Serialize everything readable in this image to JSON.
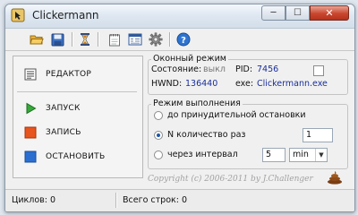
{
  "window": {
    "title": "Clickermann"
  },
  "title_buttons": {
    "minimize": "─",
    "maximize": "☐",
    "close": "✕"
  },
  "toolbar": {
    "icons": [
      "folder-open-icon",
      "save-icon",
      "hourglass-icon",
      "notepad-icon",
      "window-list-icon",
      "gear-icon",
      "help-icon"
    ]
  },
  "left_panel": {
    "editor": "РЕДАКТОР",
    "run": "ЗАПУСК",
    "record": "ЗАПИСЬ",
    "stop": "ОСТАНОВИТЬ"
  },
  "window_mode": {
    "title": "Оконный режим",
    "state_label": "Состояние:",
    "state_value": "выкл",
    "pid_label": "PID:",
    "pid_value": "7456",
    "hwnd_label": "HWND:",
    "hwnd_value": "136440",
    "exe_label": "exe:",
    "exe_value": "Clickermann.exe",
    "checkbox_checked": false
  },
  "exec_mode": {
    "title": "Режим выполнения",
    "opt_until_stop": "до принудительной остановки",
    "opt_count": "N  количество раз",
    "count_value": "1",
    "opt_interval": "через интервал",
    "interval_value": "5",
    "interval_unit": "min",
    "selected": "count"
  },
  "copyright": "Copyright (c) 2006-2011 by J.Challenger",
  "status": {
    "cycles": "Циклов: 0",
    "total_lines": "Всего строк: 0"
  },
  "colors": {
    "accent": "#1e56a8",
    "value_text": "#1a2e9a",
    "close_button": "#c9462f"
  }
}
